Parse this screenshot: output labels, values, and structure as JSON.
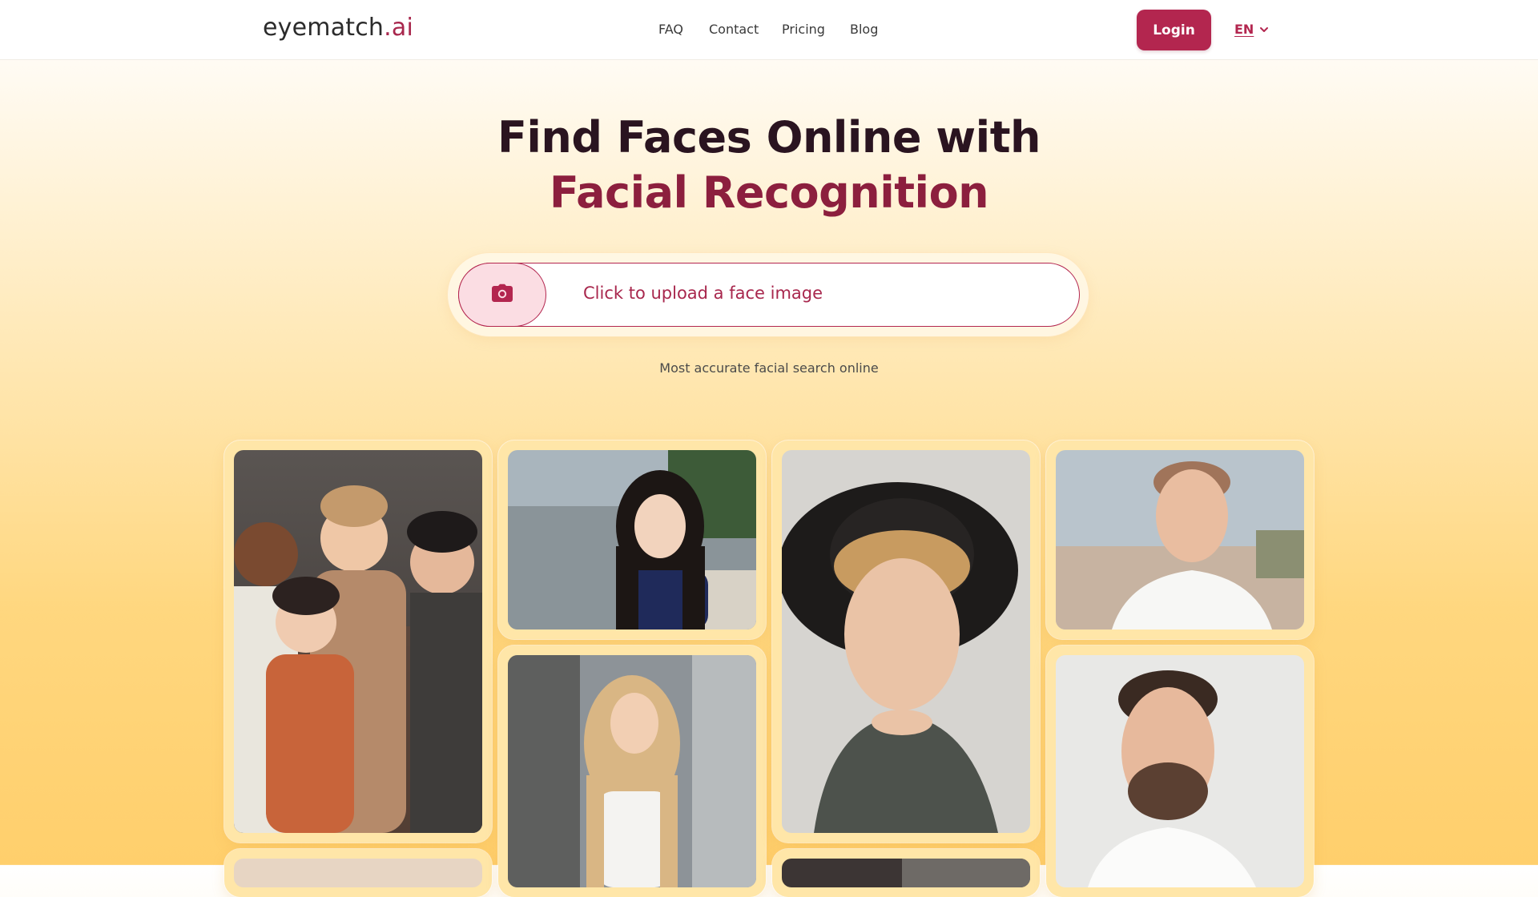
{
  "header": {
    "logo_main": "eyematch",
    "logo_accent": ".ai",
    "nav": [
      "FAQ",
      "Contact",
      "Pricing",
      "Blog"
    ],
    "login_label": "Login",
    "language": "EN"
  },
  "hero": {
    "title_line1": "Find Faces Online with",
    "title_line2": "Facial Recognition",
    "upload_label": "Click to upload a face image",
    "tagline": "Most accurate facial search online"
  },
  "icons": {
    "upload": "camera-icon",
    "language_toggle": "chevron-down-icon"
  },
  "colors": {
    "brand": "#b3264f",
    "brand_dark": "#8c1f3e",
    "background_top": "#ffffff",
    "background_bottom": "#ffcf6c",
    "card": "#ffe6a8"
  }
}
